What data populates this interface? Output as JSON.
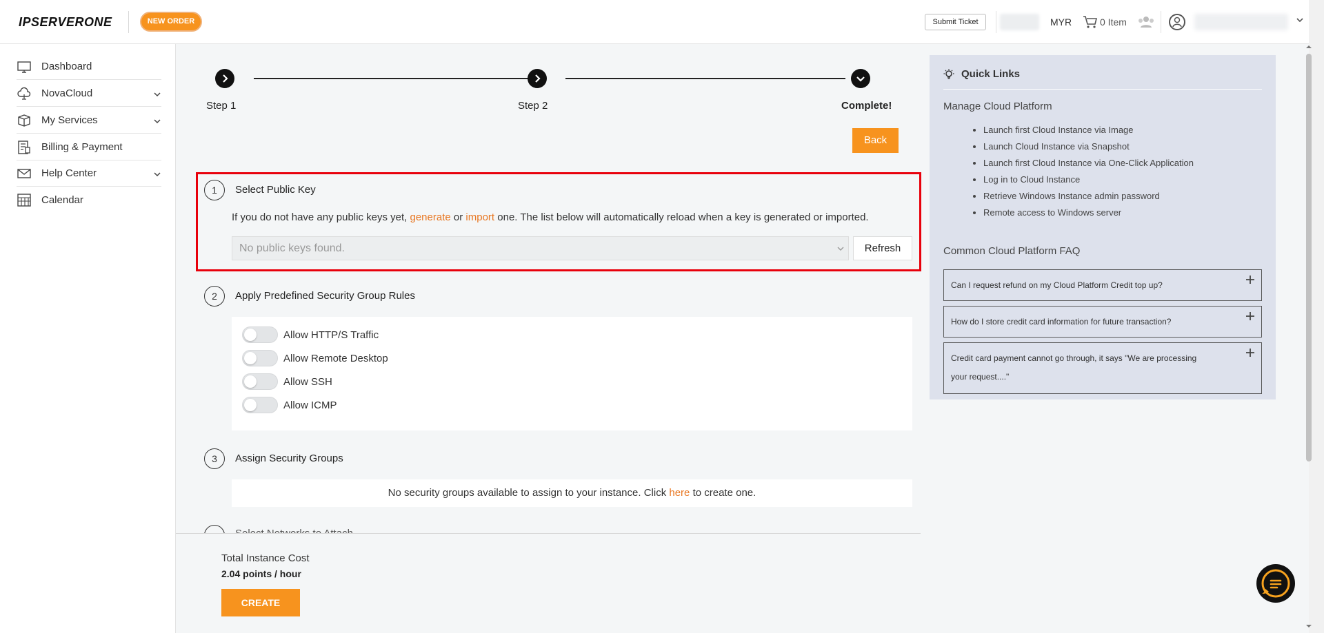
{
  "header": {
    "logo": "IPSERVERONE",
    "new_order": "NEW ORDER",
    "submit_ticket": "Submit Ticket",
    "currency": "MYR",
    "cart_items": "0 Item"
  },
  "sidebar": {
    "items": [
      {
        "label": "Dashboard",
        "icon": "monitor-icon",
        "expandable": false
      },
      {
        "label": "NovaCloud",
        "icon": "cloud-icon",
        "expandable": true
      },
      {
        "label": "My Services",
        "icon": "box-icon",
        "expandable": true
      },
      {
        "label": "Billing & Payment",
        "icon": "invoice-icon",
        "expandable": false
      },
      {
        "label": "Help Center",
        "icon": "mail-icon",
        "expandable": true
      },
      {
        "label": "Calendar",
        "icon": "calendar-icon",
        "expandable": false
      }
    ]
  },
  "stepper": {
    "step1": "Step 1",
    "step2": "Step 2",
    "step3": "Complete!"
  },
  "back_label": "Back",
  "section1": {
    "num": "1",
    "title": "Select Public Key",
    "text_before": "If you do not have any public keys yet, ",
    "generate_link": "generate",
    "text_or": " or ",
    "import_link": "import",
    "text_after": " one. The list below will automatically reload when a key is generated or imported.",
    "select_value": "No public keys found.",
    "refresh_label": "Refresh"
  },
  "section2": {
    "num": "2",
    "title": "Apply Predefined Security Group Rules",
    "toggles": [
      "Allow HTTP/S Traffic",
      "Allow Remote Desktop",
      "Allow SSH",
      "Allow ICMP"
    ]
  },
  "section3": {
    "num": "3",
    "title": "Assign Security Groups",
    "text_before": "No security groups available to assign to your instance. Click ",
    "here_link": "here",
    "text_after": " to create one."
  },
  "section4": {
    "title_partial": "Select Networks to Attach"
  },
  "footer": {
    "cost_label": "Total Instance Cost",
    "cost_value": "2.04 points / hour",
    "create_label": "CREATE"
  },
  "quick_links": {
    "title": "Quick Links",
    "manage_title": "Manage Cloud Platform",
    "links": [
      "Launch first Cloud Instance via Image",
      "Launch Cloud Instance via Snapshot",
      "Launch first Cloud Instance via One-Click Application",
      "Log in to Cloud Instance",
      "Retrieve Windows Instance admin password",
      "Remote access to Windows server"
    ],
    "faq_title": "Common Cloud Platform FAQ",
    "faqs": [
      "Can I request refund on my Cloud Platform Credit top up?",
      "How do I store credit card information for future transaction?",
      "Credit card payment cannot go through, it says \"We are processing your request....\""
    ]
  },
  "colors": {
    "accent": "#f7931e",
    "link": "#e87722",
    "highlight": "#e8000b",
    "quick_links_bg": "#dde1ec"
  }
}
